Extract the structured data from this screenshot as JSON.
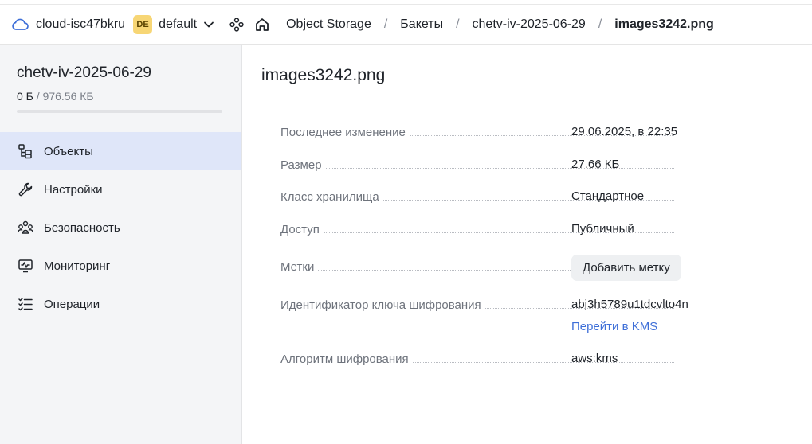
{
  "header": {
    "cloud_name": "cloud-isc47bkru",
    "folder_badge": "DE",
    "folder_name": "default",
    "breadcrumbs": [
      "Object Storage",
      "Бакеты",
      "chetv-iv-2025-06-29"
    ],
    "separator": "/",
    "current": "images3242.png"
  },
  "sidebar": {
    "bucket_name": "chetv-iv-2025-06-29",
    "usage_used": "0 Б",
    "usage_total": "/ 976.56 КБ",
    "usage_fraction": 0,
    "items": [
      {
        "label": "Объекты",
        "icon": "objects-icon",
        "active": true
      },
      {
        "label": "Настройки",
        "icon": "wrench-icon",
        "active": false
      },
      {
        "label": "Безопасность",
        "icon": "users-icon",
        "active": false
      },
      {
        "label": "Мониторинг",
        "icon": "monitor-icon",
        "active": false
      },
      {
        "label": "Операции",
        "icon": "list-icon",
        "active": false
      }
    ]
  },
  "main": {
    "title": "images3242.png",
    "props": {
      "modified_label": "Последнее изменение",
      "modified_value": "29.06.2025, в 22:35",
      "size_label": "Размер",
      "size_value": "27.66 КБ",
      "class_label": "Класс хранилища",
      "class_value": "Стандартное",
      "access_label": "Доступ",
      "access_value": "Публичный",
      "tags_label": "Метки",
      "tags_button": "Добавить метку",
      "key_label": "Идентификатор ключа шифрования",
      "key_value": "abj3h5789u1tdcvlto4n",
      "kms_link": "Перейти в KMS",
      "algo_label": "Алгоритм шифрования",
      "algo_value": "aws:kms"
    }
  },
  "colors": {
    "accent": "#5282ff",
    "link": "#3e6fd8",
    "sidebar_bg": "#f4f5f7",
    "active_bg": "#dfe6f9",
    "badge": "#f7d675"
  }
}
